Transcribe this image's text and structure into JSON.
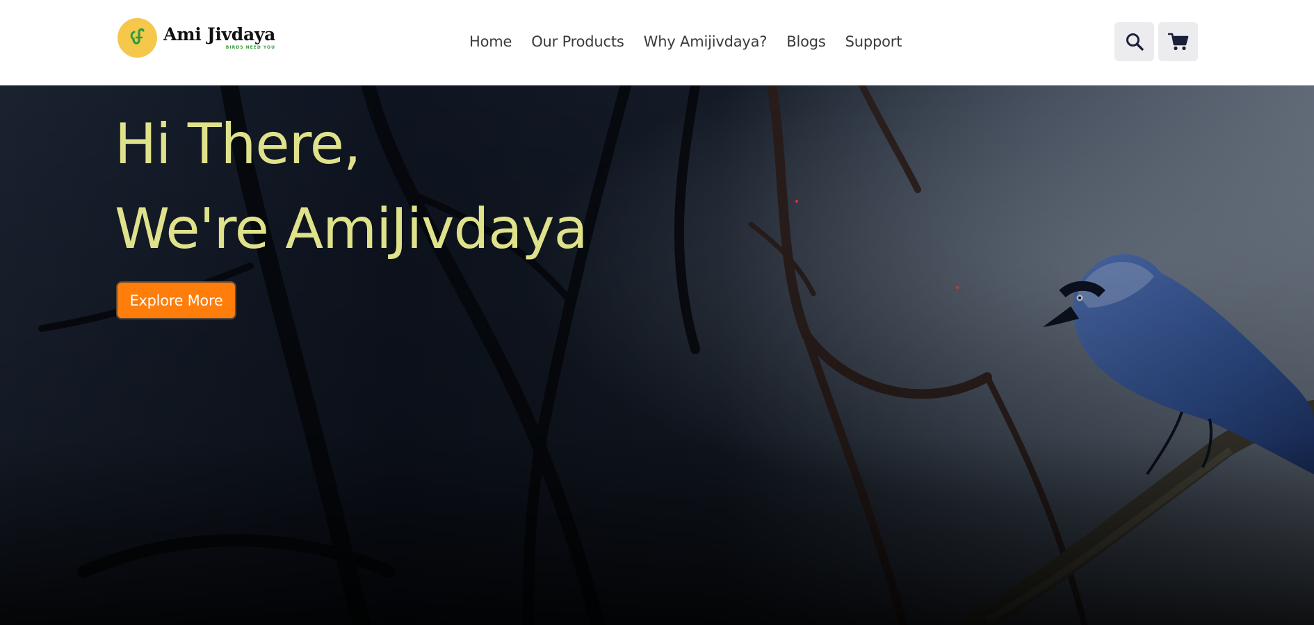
{
  "brand": {
    "name": "Ami Jivdaya",
    "tagline": "BIRDS NEED YOU",
    "colors": {
      "logo_circle": "#f5c74a",
      "logo_mark": "#2f9b3a"
    }
  },
  "nav": {
    "items": [
      {
        "label": "Home"
      },
      {
        "label": "Our Products"
      },
      {
        "label": "Why Amijivdaya?"
      },
      {
        "label": "Blogs"
      },
      {
        "label": "Support"
      }
    ]
  },
  "actions": {
    "search_icon": "search-icon",
    "cart_icon": "cart-icon"
  },
  "hero": {
    "line1": "Hi There,",
    "line2": "We're AmiJivdaya",
    "cta_label": "Explore More",
    "colors": {
      "headline": "#dfe28a",
      "cta": "#ff7d0a"
    }
  }
}
